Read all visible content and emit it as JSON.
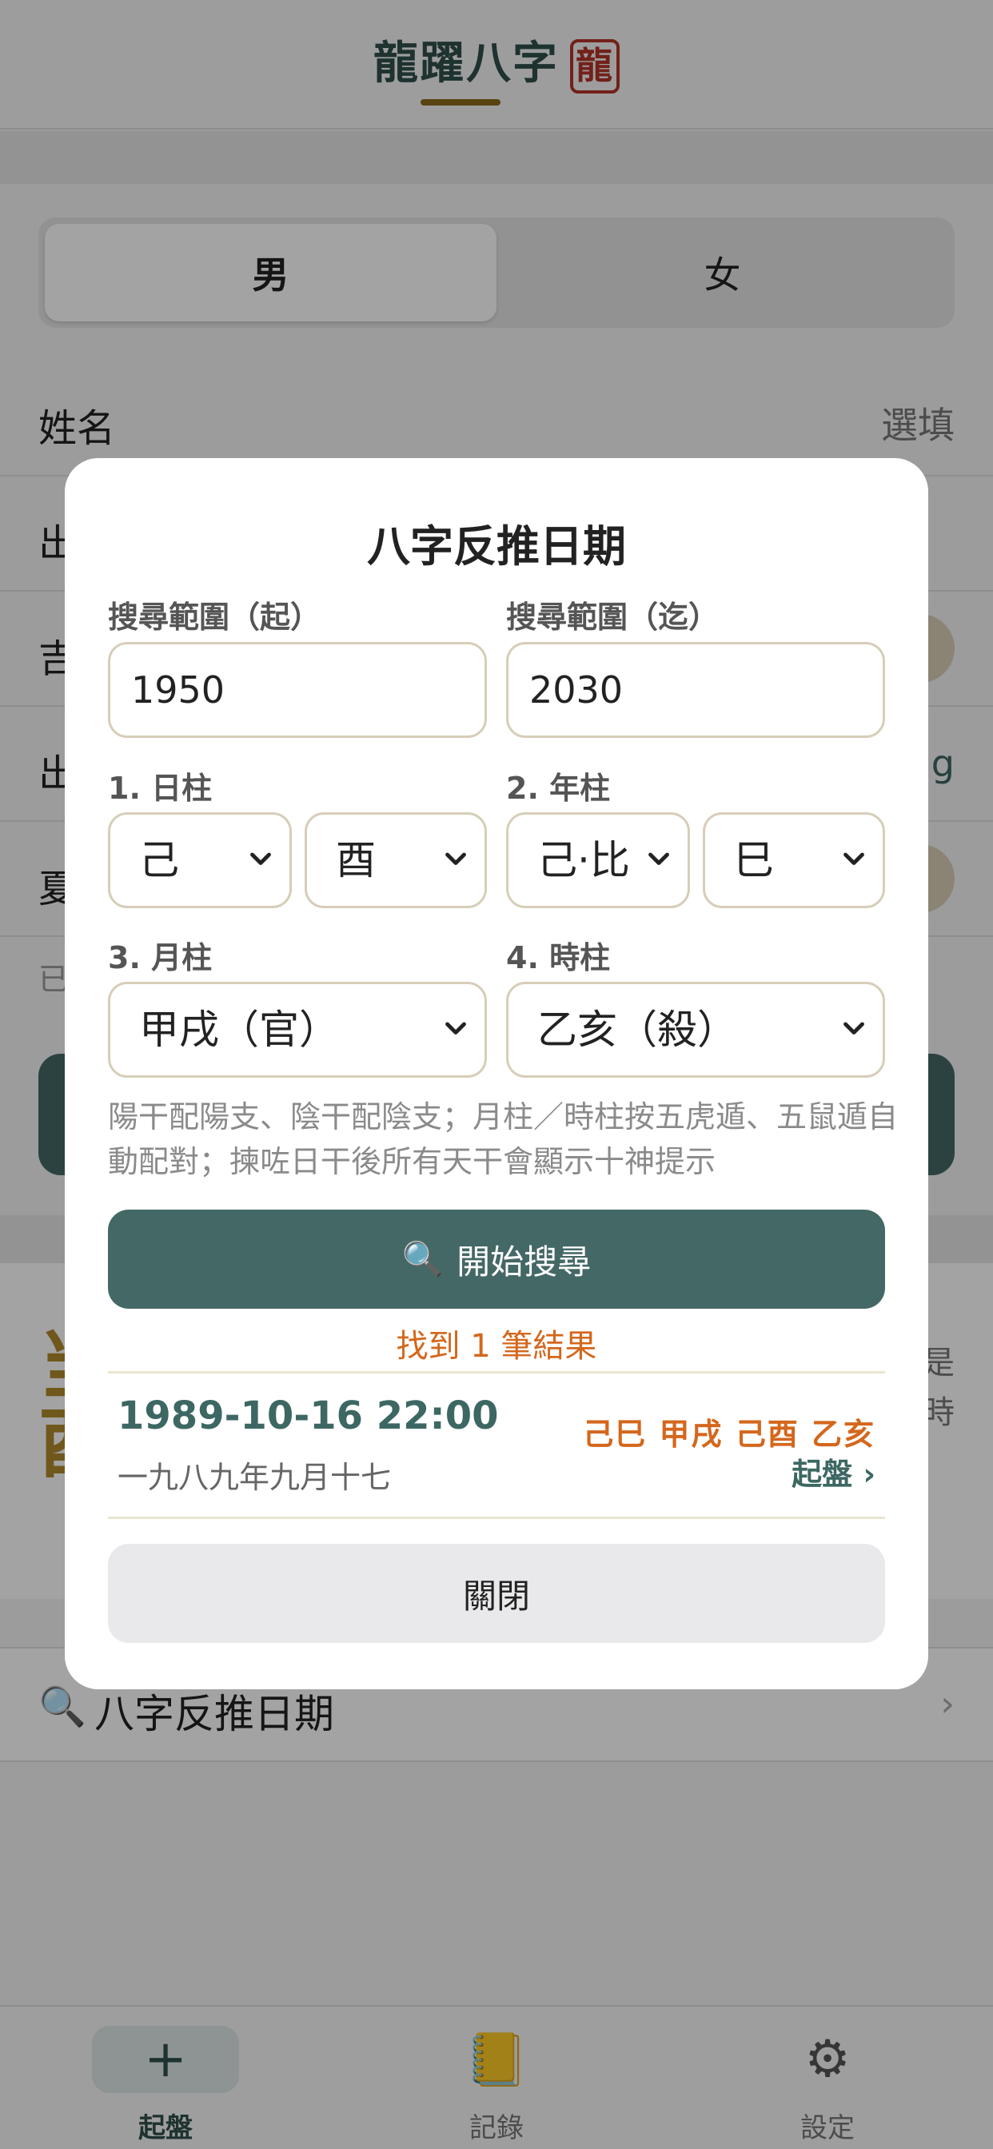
{
  "app": {
    "title": "龍躍八字",
    "seal": "龍",
    "gender": {
      "male": "男",
      "female": "女"
    },
    "name_row": {
      "label": "姓名",
      "placeholder": "選填"
    },
    "row2_label": "出",
    "row3_label": "吉",
    "row4_label": "出",
    "row4_value": "g",
    "row5_label": "夏",
    "hint": "已",
    "glyph_top": "当",
    "glyph_bottom": "酉",
    "side_top": "是",
    "side_bottom": "時",
    "reverse_row": {
      "icon": "🔍",
      "label": "八字反推日期",
      "chevron": "›"
    }
  },
  "tabbar": [
    {
      "icon": "+",
      "label": "起盤",
      "active": true
    },
    {
      "icon": "📒",
      "label": "記錄",
      "active": false
    },
    {
      "icon": "⚙",
      "label": "設定",
      "active": false
    }
  ],
  "modal": {
    "title": "八字反推日期",
    "range_start_label": "搜尋範圍（起）",
    "range_end_label": "搜尋範圍（迄）",
    "range_start": "1950",
    "range_end": "2030",
    "day_label": "1. 日柱",
    "year_label": "2. 年柱",
    "month_label": "3. 月柱",
    "hour_label": "4. 時柱",
    "day_stem": "己",
    "day_branch": "酉",
    "year_stem": "己·比",
    "year_branch": "巳",
    "month": "甲戌（官）",
    "hour": "乙亥（殺）",
    "note": "陽干配陽支、陰干配陰支；月柱／時柱按五虎遁、五鼠遁自動配對；揀咗日干後所有天干會顯示十神提示",
    "search_icon": "🔍",
    "search_button": "開始搜尋",
    "result_count": "找到 1 筆結果",
    "result": {
      "date": "1989-10-16 22:00",
      "lunar": "一九八九年九月十七",
      "pillars": "己巳 甲戌 己酉 乙亥",
      "link": "起盤 ›"
    },
    "close_button": "關閉"
  },
  "colors": {
    "accent_teal": "#446866",
    "accent_orange": "#d4671c",
    "gold": "#8a6a1c",
    "seal_red": "#b3342a"
  }
}
